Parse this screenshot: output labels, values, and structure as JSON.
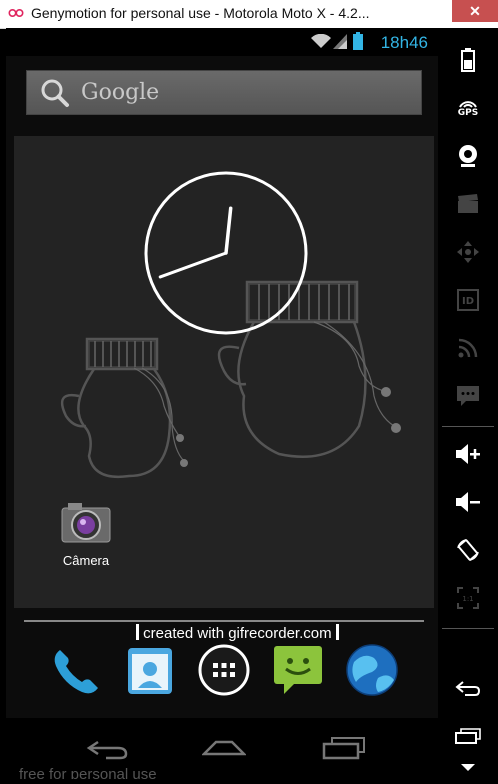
{
  "window": {
    "title": "Genymotion for personal use - Motorola Moto X - 4.2...",
    "close_label": "✕"
  },
  "status_bar": {
    "time": "18h46",
    "accent": "#33b5e5"
  },
  "search": {
    "label": "Google"
  },
  "home": {
    "camera_label": "Câmera",
    "clock_hour_angle": 6,
    "clock_minute_angle": 250
  },
  "watermark": {
    "text": "created with gifrecorder.com"
  },
  "dock": {
    "apps": [
      "phone",
      "contacts",
      "app-drawer",
      "messaging",
      "browser"
    ]
  },
  "nav": {
    "buttons": [
      "back",
      "home",
      "recent-apps"
    ],
    "free_text": "free for personal use"
  },
  "sidebar": {
    "tools": [
      "battery",
      "gps",
      "webcam",
      "camera-capture",
      "dpad",
      "device-id",
      "cast",
      "sms",
      "volume-up",
      "volume-down",
      "rotate",
      "scale",
      "back",
      "home",
      "menu"
    ],
    "gps_label": "GPS"
  }
}
